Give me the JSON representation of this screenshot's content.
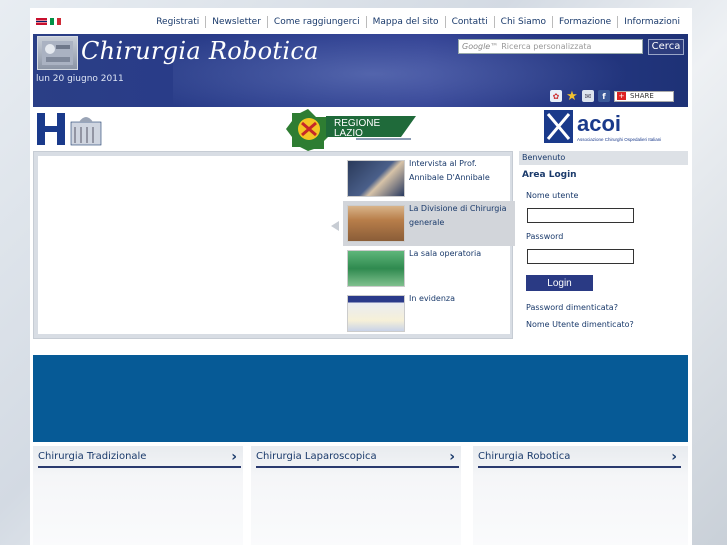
{
  "header": {
    "menu": [
      "Registrati",
      "Newsletter",
      "Come raggiungerci",
      "Mappa del sito",
      "Contatti",
      "Chi Siamo",
      "Formazione",
      "Informazioni"
    ],
    "site_title": "Chirurgia Robotica",
    "date": "lun 20 giugno 2011",
    "search": {
      "google_label": "Google™",
      "placeholder": "Ricerca personalizzata",
      "button": "Cerca"
    },
    "share_label": "SHARE"
  },
  "logos": {
    "lazio_line1": "REGIONE",
    "lazio_line2": "LAZIO",
    "acoi_name": "acoi",
    "acoi_sub": "Associazione Chirurghi Ospedalieri Italiani"
  },
  "slider": {
    "items": [
      {
        "line1": "Intervista al Prof.",
        "line2": "Annibale D'Annibale"
      },
      {
        "line1": "La Divisione di Chirurgia",
        "line2": "generale"
      },
      {
        "line1": "La sala operatoria",
        "line2": ""
      },
      {
        "line1": "In evidenza",
        "line2": ""
      }
    ]
  },
  "login": {
    "welcome": "Benvenuto",
    "area": "Area Login",
    "username_label": "Nome utente",
    "password_label": "Password",
    "button": "Login",
    "forgot_password": "Password dimenticata?",
    "forgot_username": "Nome Utente dimenticato?"
  },
  "sections": [
    "Chirurgia Tradizionale",
    "Chirurgia Laparoscopica",
    "Chirurgia Robotica"
  ],
  "colors": {
    "banner": "#2b3f86",
    "band": "#065a96",
    "accent": "#1a3a6b"
  }
}
